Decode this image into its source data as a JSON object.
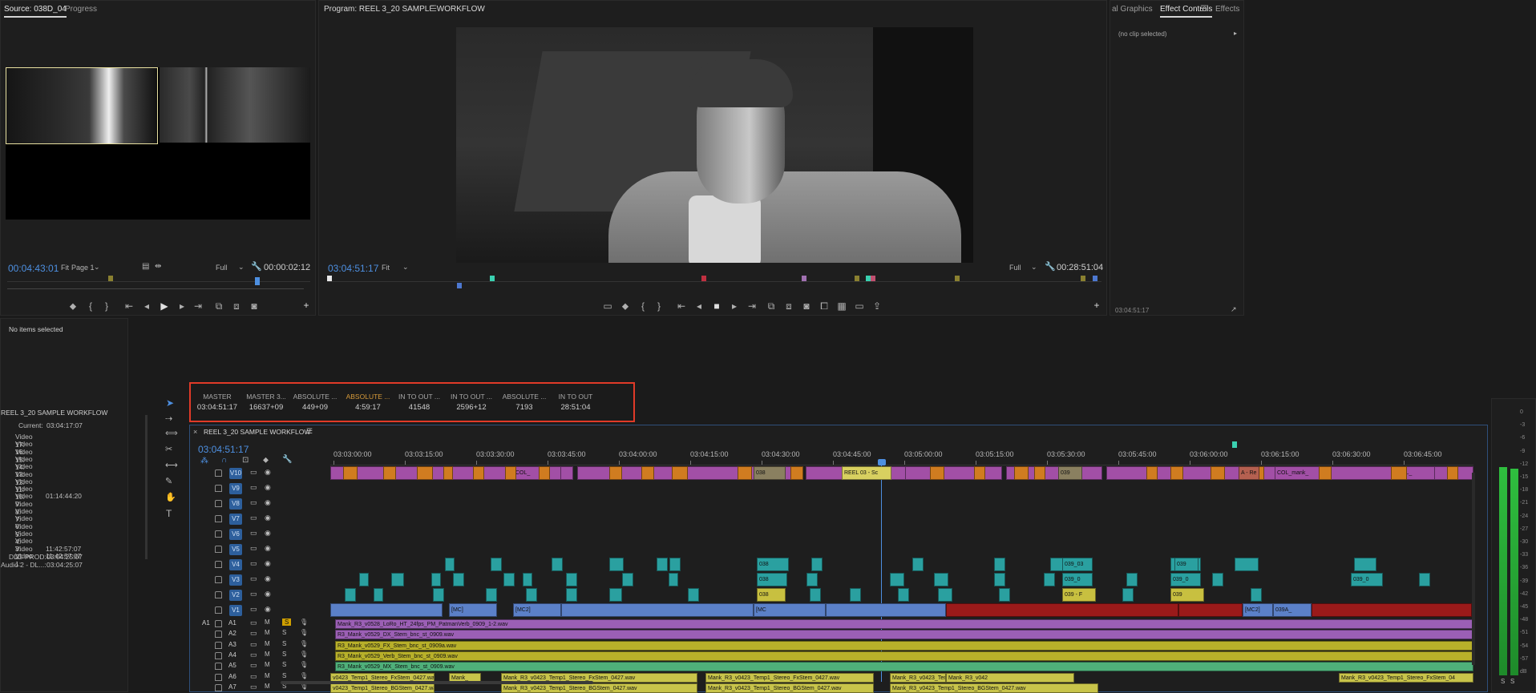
{
  "source_panel": {
    "tabs": [
      "Source: 038D_04",
      "Progress"
    ],
    "timecode": "00:04:43:01",
    "fit": "Fit",
    "page": "Page 1",
    "quality": "Full",
    "duration": "00:00:02:12"
  },
  "program_panel": {
    "title": "Program: REEL 3_20 SAMPLE WORKFLOW",
    "timecode": "03:04:51:17",
    "fit": "Fit",
    "quality": "Full",
    "duration": "00:28:51:04"
  },
  "right_panel": {
    "tabs": [
      "al Graphics",
      "Effect Controls",
      "Effects"
    ],
    "no_clip": "(no clip selected)",
    "timecode": "03:04:51:17"
  },
  "left_panel": {
    "no_items": "No items selected",
    "sequence": "REEL 3_20 SAMPLE WORKFLOW",
    "current_label": "Current:",
    "current_value": "03:04:17:07",
    "rows": [
      {
        "label": "Video 17:",
        "value": ""
      },
      {
        "label": "Video 16:",
        "value": ""
      },
      {
        "label": "Video 15:",
        "value": ""
      },
      {
        "label": "Video 14:",
        "value": ""
      },
      {
        "label": "Video 13:",
        "value": ""
      },
      {
        "label": "Video 12:",
        "value": ""
      },
      {
        "label": "Video 11:",
        "value": ""
      },
      {
        "label": "Video 10:",
        "value": ""
      },
      {
        "label": "Video 9:",
        "value": "01:14:44:20"
      },
      {
        "label": "Video 8:",
        "value": ""
      },
      {
        "label": "Video 7:",
        "value": ""
      },
      {
        "label": "Video 6:",
        "value": ""
      },
      {
        "label": "Video 5:",
        "value": ""
      },
      {
        "label": "Video 4:",
        "value": ""
      },
      {
        "label": "Video 3:",
        "value": ""
      },
      {
        "label": "Video 2:",
        "value": "11:42:57:07"
      },
      {
        "label": "Video 1:",
        "value": "11:42:57:07"
      }
    ],
    "dlg_label": "DLG PROD:",
    "dlg_value": "03:04:25:07",
    "audio2_label": "Audio 2 - DL...:",
    "audio2_value": "03:04:25:07"
  },
  "timecode_readouts": [
    {
      "label": "MASTER",
      "value": "03:04:51:17",
      "active": false
    },
    {
      "label": "MASTER 3...",
      "value": "16637+09",
      "active": false
    },
    {
      "label": "ABSOLUTE ...",
      "value": "449+09",
      "active": false
    },
    {
      "label": "ABSOLUTE ...",
      "value": "4:59:17",
      "active": true
    },
    {
      "label": "IN TO OUT ...",
      "value": "41548",
      "active": false
    },
    {
      "label": "IN TO OUT ...",
      "value": "2596+12",
      "active": false
    },
    {
      "label": "ABSOLUTE ...",
      "value": "7193",
      "active": false
    },
    {
      "label": "IN TO OUT",
      "value": "28:51:04",
      "active": false
    }
  ],
  "timeline": {
    "title": "REEL 3_20 SAMPLE WORKFLOW",
    "timecode": "03:04:51:17",
    "ruler": [
      "03:03:00:00",
      "03:03:15:00",
      "03:03:30:00",
      "03:03:45:00",
      "03:04:00:00",
      "03:04:15:00",
      "03:04:30:00",
      "03:04:45:00",
      "03:05:00:00",
      "03:05:15:00",
      "03:05:30:00",
      "03:05:45:00",
      "03:06:00:00",
      "03:06:15:00",
      "03:06:30:00",
      "03:06:45:00"
    ],
    "video_tracks": [
      "V10",
      "V9",
      "V8",
      "V7",
      "V6",
      "V5",
      "V4",
      "V3",
      "V2",
      "V1"
    ],
    "audio_tracks": [
      "A1",
      "A2",
      "A3",
      "A4",
      "A5",
      "A6",
      "A7"
    ],
    "source_patch": "A1",
    "audio_clips": [
      "Mank_R3_v0528_LoRo_HT_24fps_PM_PatmanVerb_0909_1-2.wav",
      "R3_Mank_v0529_DX_Stem_bnc_st_0909.wav",
      "R3_Mank_v0529_FX_Stem_bnc_st_0909a.wav",
      "R3_Mank_v0529_Verb_Stem_bnc_st_0909.wav",
      "R3_Mank_v0529_MX_Stem_bnc_st_0909.wav"
    ],
    "a6_clips": [
      "v0423_Temp1_Stereo_FxStem_0427.wav",
      "Mank_",
      "Mank_R3_v0423_Temp1_Stereo_FxStem_0427.wav",
      "Mank_R3_v0423_Temp1_Stereo_FxStem_0427.wav",
      "Mank_R3_v0423_Temp1_Stereo_FxStem_0427.wav",
      "Mank_R3_v042",
      "Mank_R3_v0423_Temp1_Stereo_FxStem_04"
    ],
    "a7_clips": [
      "v0423_Temp1_Stereo_BGStem_0427.wav",
      "Mank_R3_v0423_Temp1_Stereo_BGStem_0427.wav",
      "Mank_R3_v0423_Temp1_Stereo_BGStem_0427.wav",
      "Mank_R3_v0423_Temp1_Stereo_BGStem_0427.wav"
    ],
    "v10_labels": [
      "COL_",
      "COL_mank_",
      "COL_mank_",
      "COL_"
    ],
    "v9_labels": [
      "REEL 03 - Sc",
      "038",
      "038",
      "039",
      "039",
      "039",
      "A - Re"
    ],
    "v2_labels": [
      "038",
      "039 - F",
      "039"
    ],
    "v1_labels": [
      "[MC]",
      "[MC2]",
      "[MC",
      "[MC2]",
      "039A_"
    ],
    "v4_labels": [
      "038",
      "039_03",
      "039"
    ],
    "v3_labels": [
      "038",
      "039_0",
      "039_0",
      "039_0"
    ]
  },
  "meter_scale": [
    "0",
    "-3",
    "-6",
    "-9",
    "-12",
    "-15",
    "-18",
    "-21",
    "-24",
    "-27",
    "-30",
    "-33",
    "-36",
    "-39",
    "-42",
    "-45",
    "-48",
    "-51",
    "-54",
    "-57",
    "dB"
  ],
  "meter_bottom": [
    "S",
    "S"
  ],
  "colors": {
    "accent_blue": "#4d8fe0",
    "highlight": "#e05030",
    "v_purple": "#a24fa6",
    "v_orange": "#d07c20",
    "v_teal": "#2aa0a0",
    "v_blue": "#5b80c8",
    "v_red": "#9a1a1a",
    "a_purple": "#9b5fb5",
    "a_green": "#4fb07a",
    "a_yellow": "#b8b02a"
  }
}
